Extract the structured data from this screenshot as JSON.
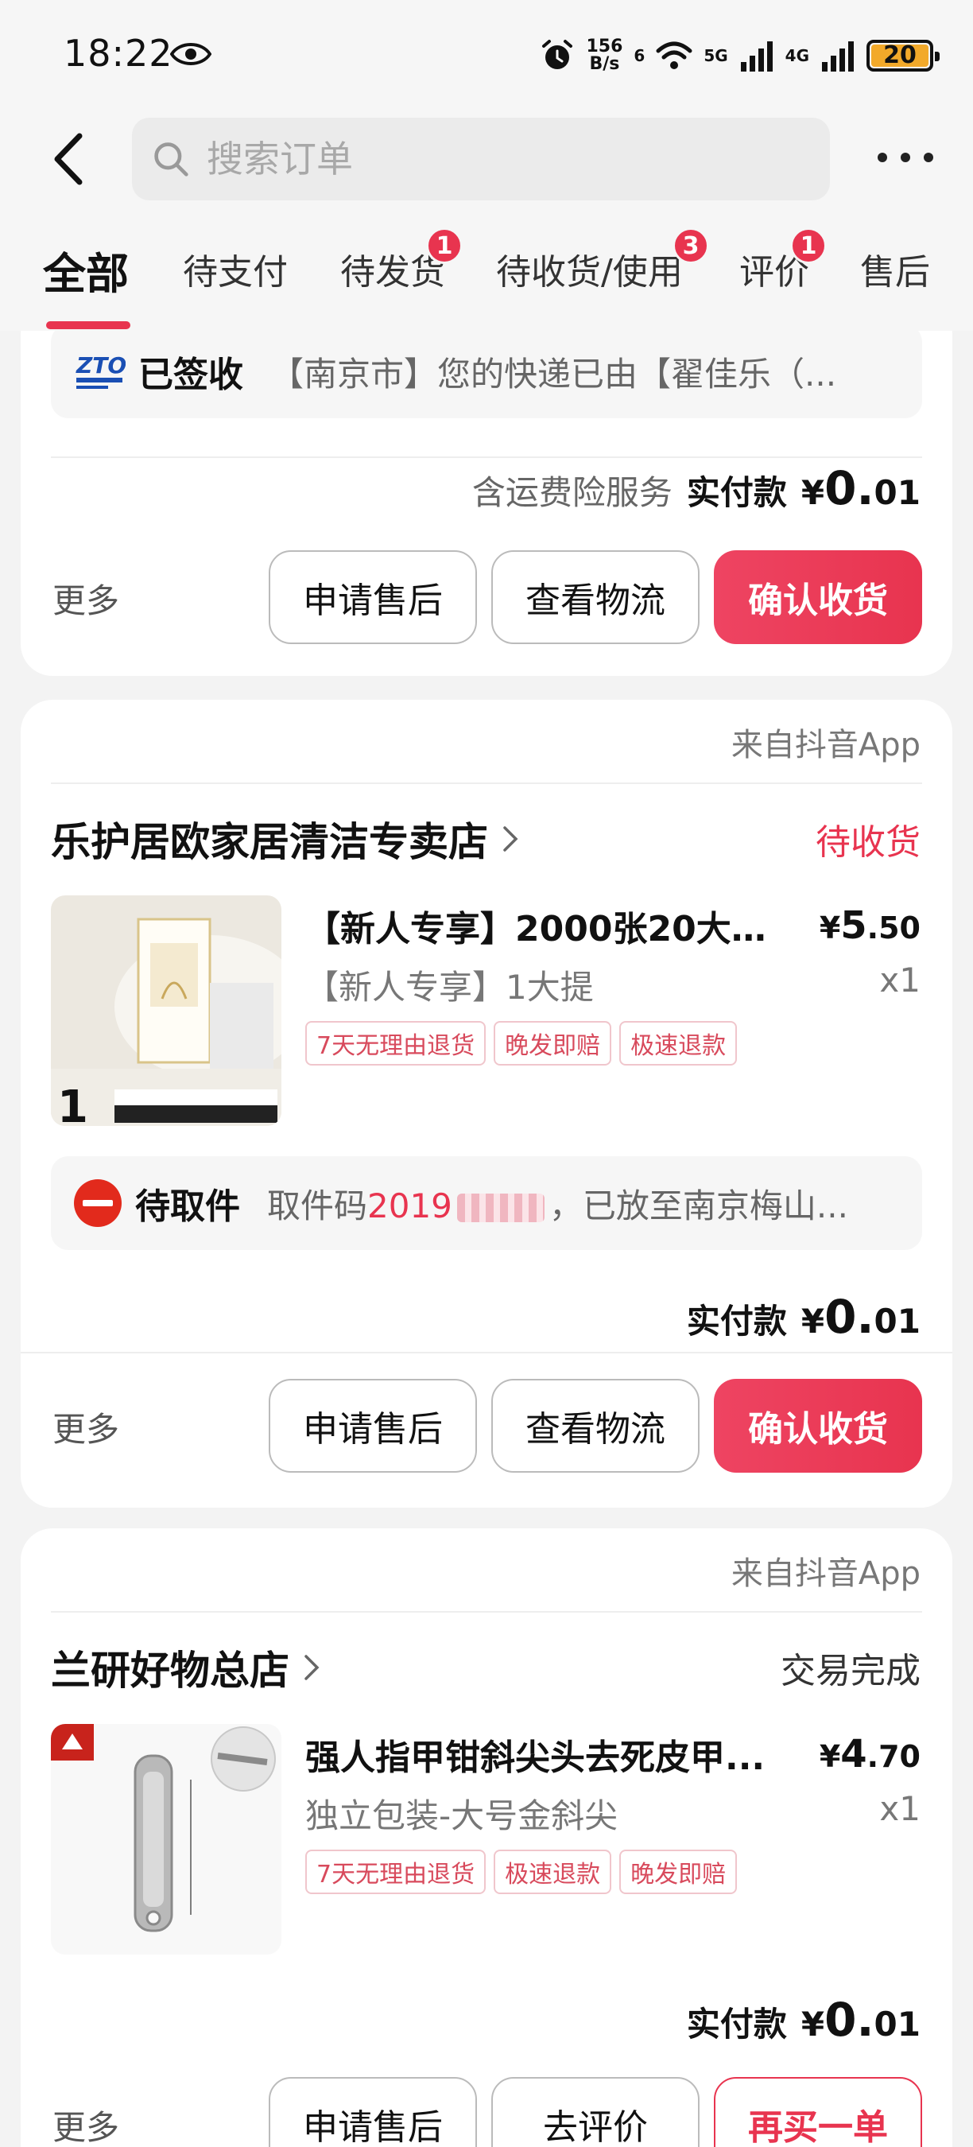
{
  "status_bar": {
    "time": "18:22",
    "net_speed_value": "156",
    "net_speed_unit": "B/s",
    "wifi_label": "6",
    "sig1_label": "5G",
    "sig2_label": "4G",
    "battery": "20"
  },
  "search": {
    "placeholder": "搜索订单"
  },
  "tabs": [
    {
      "label": "全部",
      "active": true
    },
    {
      "label": "待支付"
    },
    {
      "label": "待发货",
      "badge": "1"
    },
    {
      "label": "待收货/使用",
      "badge": "3"
    },
    {
      "label": "评价",
      "badge": "1"
    },
    {
      "label": "售后"
    }
  ],
  "order1": {
    "logistic_title": "已签收",
    "logistic_text": "【南京市】您的快递已由【翟佳乐（...",
    "pay_note": "含运费险服务",
    "pay_label": "实付款",
    "pay_currency": "¥",
    "pay_big": "0.",
    "pay_small": "01",
    "more": "更多",
    "buttons": [
      "申请售后",
      "查看物流",
      "确认收货"
    ]
  },
  "order2": {
    "source": "来自抖音App",
    "shop": "乐护居欧家居清洁专卖店",
    "status": "待收货",
    "product_title": "【新人专享】2000张20大提...",
    "price_currency": "¥",
    "price_big": "5",
    "price_small": ".50",
    "spec": "【新人专享】1大提",
    "qty": "x1",
    "tags": [
      "7天无理由退货",
      "晚发即赔",
      "极速退款"
    ],
    "logistic_title": "待取件",
    "code_prefix": "取件码",
    "code": "2019",
    "logistic_rest": "，已放至南京梅山...",
    "pay_label": "实付款",
    "pay_currency": "¥",
    "pay_big": "0.",
    "pay_small": "01",
    "more": "更多",
    "buttons": [
      "申请售后",
      "查看物流",
      "确认收货"
    ]
  },
  "order3": {
    "source": "来自抖音App",
    "shop": "兰研好物总店",
    "status": "交易完成",
    "product_title": "强人指甲钳斜尖头去死皮甲...",
    "price_currency": "¥",
    "price_big": "4",
    "price_small": ".70",
    "spec": "独立包装-大号金斜尖",
    "qty": "x1",
    "tags": [
      "7天无理由退货",
      "极速退款",
      "晚发即赔"
    ],
    "pay_label": "实付款",
    "pay_currency": "¥",
    "pay_big": "0.",
    "pay_small": "01",
    "more": "更多",
    "buttons": [
      "申请售后",
      "去评价",
      "再买一单"
    ]
  },
  "colors": {
    "accent": "#e8344f",
    "background": "#f3f3f3"
  }
}
